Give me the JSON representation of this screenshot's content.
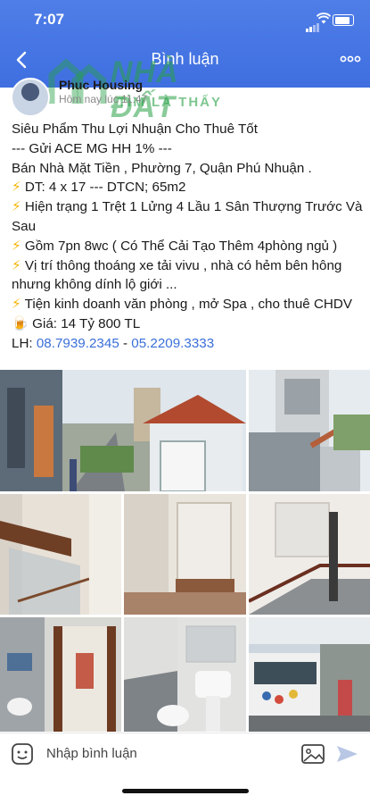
{
  "status_bar": {
    "time": "7:07"
  },
  "header": {
    "title": "Bình luận",
    "back_icon": "chevron-left-icon",
    "more_icon": "more-dots-icon"
  },
  "watermark": {
    "brand": "NHÀ ĐẤT",
    "slogan": "TÌM LÀ THẤY"
  },
  "post": {
    "author": "Phuc Housing",
    "timestamp": "Hôm nay lúc 11:47",
    "lines": [
      {
        "prefix": "",
        "text": "Siêu Phẩm Thu Lợi Nhuận Cho Thuê Tốt"
      },
      {
        "prefix": "",
        "text": "--- Gửi ACE MG HH 1% ---"
      },
      {
        "prefix": "",
        "text": "Bán Nhà Mặt Tiền , Phường 7, Quận Phú Nhuận ."
      },
      {
        "prefix": "⚡",
        "text": " DT: 4 x 17 --- DTCN; 65m2"
      },
      {
        "prefix": "⚡",
        "text": " Hiện trạng 1 Trệt 1 Lửng 4 Lầu 1 Sân Thượng Trước Và Sau"
      },
      {
        "prefix": "⚡",
        "text": " Gồm 7pn 8wc ( Có Thể Cải Tạo Thêm 4phòng ngủ )"
      },
      {
        "prefix": "⚡",
        "text": " Vị trí thông thoáng xe tải vivu , nhà có hẻm bên hông nhưng không dính lộ giới ..."
      },
      {
        "prefix": "⚡",
        "text": " Tiện kinh doanh văn phòng , mở Spa , cho thuê CHDV"
      },
      {
        "prefix": "🍺",
        "text": " Giá: 14 Tỷ 800 TL"
      }
    ],
    "contact_label": "LH: ",
    "phone1": "08.7939.2345",
    "phone_sep": " - ",
    "phone2": "05.2209.3333"
  },
  "photos": [
    {
      "name": "photo-street-house"
    },
    {
      "name": "photo-building-exterior"
    },
    {
      "name": "photo-staircase-interior"
    },
    {
      "name": "photo-window-room"
    },
    {
      "name": "photo-staircase-railing"
    },
    {
      "name": "photo-bathroom-door"
    },
    {
      "name": "photo-bathroom-tiles"
    },
    {
      "name": "photo-street-truck"
    }
  ],
  "comment_bar": {
    "placeholder": "Nhập bình luận",
    "emoji_icon": "emoji-icon",
    "image_icon": "image-icon",
    "send_icon": "send-icon"
  },
  "colors": {
    "header": "#4473e4",
    "link": "#3a6fd8",
    "bolt": "#f5b400"
  }
}
